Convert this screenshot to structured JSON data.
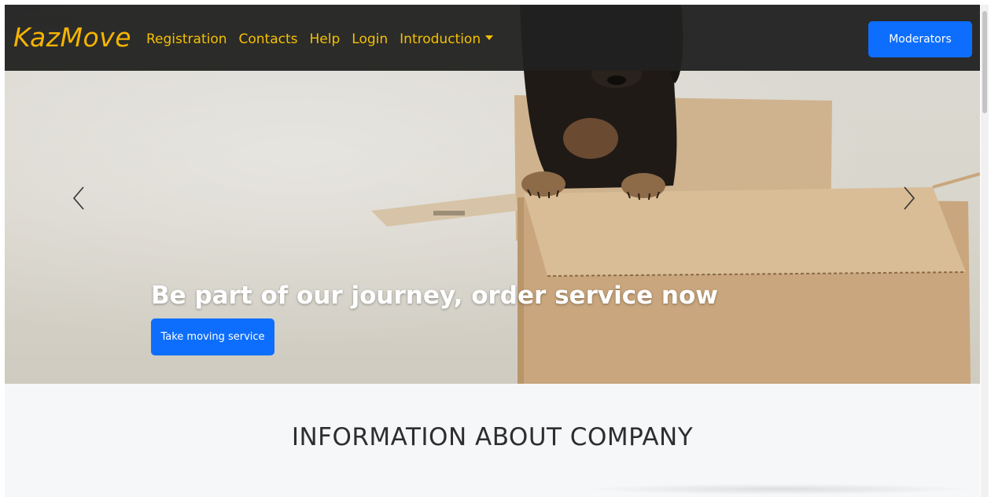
{
  "navbar": {
    "brand": "KazMove",
    "links": [
      "Registration",
      "Contacts",
      "Help",
      "Login",
      "Introduction"
    ],
    "moderators_label": "Moderators"
  },
  "hero": {
    "caption": "Be part of our journey, order service now",
    "button_label": "Take moving service",
    "prev_icon": "chevron-left-icon",
    "next_icon": "chevron-right-icon"
  },
  "info": {
    "title": "INFORMATION ABOUT COMPANY"
  },
  "colors": {
    "navbar_bg": "#212121",
    "brand": "#f5b400",
    "link": "#f5c000",
    "primary": "#0d6efd"
  }
}
